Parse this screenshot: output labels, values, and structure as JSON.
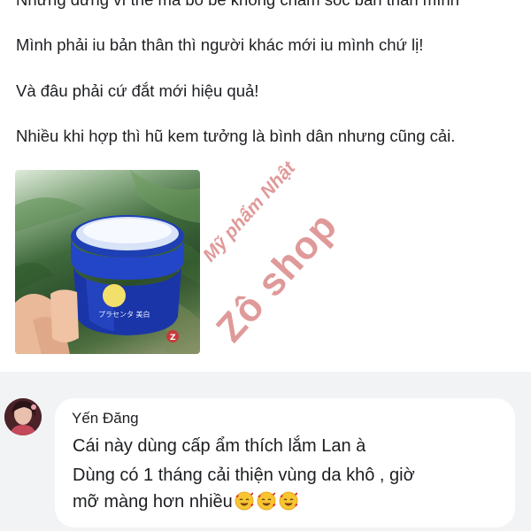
{
  "post": {
    "lines": [
      "Nhưng đừng vì thế mà bỏ bê không chăm sóc bản thân mình",
      "Mình phải iu bản thân thì người khác mới iu mình chứ lị!",
      "Và đâu phải cứ đắt mới hiệu quả!",
      "Nhiều khi hợp thì hũ kem tưởng là bình dân nhưng cũng cải."
    ]
  },
  "watermark": {
    "small": "Mỹ phẩm Nhật",
    "big": "Zô shop"
  },
  "comment": {
    "author": "Yến Đăng",
    "lines": [
      "Cái này dùng cấp ẩm thích lắm Lan à",
      "Dùng có 1 tháng cải thiện vùng da khô , giờ",
      "mỡ màng hơn nhiều"
    ],
    "emoji_count": 3,
    "emoji_icon": "smiling-face-with-hearts-icon"
  },
  "colors": {
    "comment_background": "#f2f3f5",
    "watermark": "#cd5a5a",
    "jar_blue": "#1f3fb5"
  }
}
